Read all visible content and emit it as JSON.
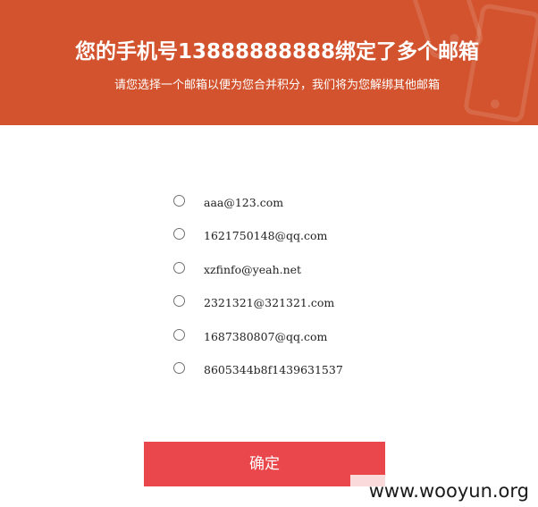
{
  "header": {
    "title": "您的手机号13888888888绑定了多个邮箱",
    "subtitle": "请您选择一个邮箱以便为您合并积分，我们将为您解绑其他邮箱",
    "background_color": "#d2532d"
  },
  "email_options": [
    {
      "label": "aaa@123.com",
      "selected": false
    },
    {
      "label": "1621750148@qq.com",
      "selected": false
    },
    {
      "label": "xzfinfo@yeah.net",
      "selected": false
    },
    {
      "label": "2321321@321321.com",
      "selected": false
    },
    {
      "label": "1687380807@qq.com",
      "selected": false
    },
    {
      "label": "8605344b8f1439631537",
      "selected": false
    }
  ],
  "confirm_button": {
    "label": "确定",
    "color": "#e9474b"
  },
  "watermark": {
    "text": "www.wooyun.org"
  }
}
